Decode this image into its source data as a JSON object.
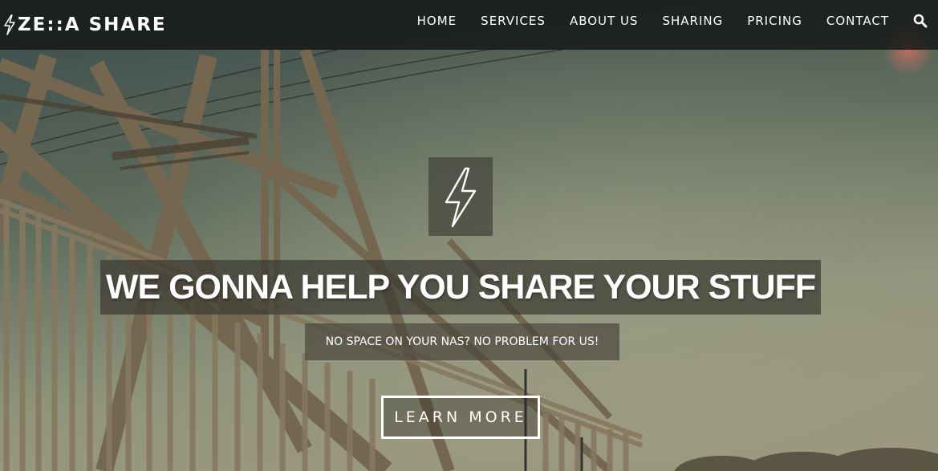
{
  "brand": {
    "name": "ZE::A SHARE",
    "icon": "lightning-bolt-icon"
  },
  "nav": {
    "items": [
      {
        "label": "HOME"
      },
      {
        "label": "SERVICES"
      },
      {
        "label": "ABOUT US"
      },
      {
        "label": "SHARING"
      },
      {
        "label": "PRICING"
      },
      {
        "label": "CONTACT"
      }
    ],
    "search_icon": "search-icon"
  },
  "hero": {
    "icon": "lightning-bolt-icon",
    "title": "WE GONNA HELP YOU SHARE YOUR STUFF",
    "subtitle": "NO SPACE ON YOUR NAS? NO PROBLEM FOR US!",
    "cta_label": "LEARN MORE"
  },
  "colors": {
    "nav_background": "#151717",
    "text": "#ffffff",
    "sky_top": "#3c4c4c",
    "sky_bottom": "#8e947c"
  }
}
